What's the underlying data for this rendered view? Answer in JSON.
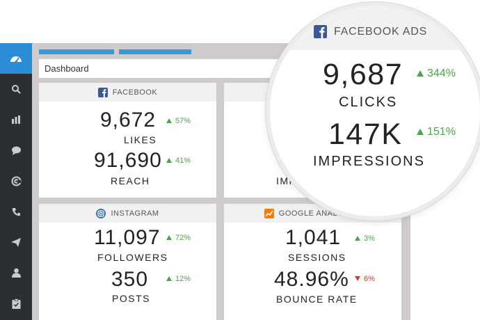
{
  "breadcrumb": "Dashboard",
  "sidebar": {
    "items": [
      {
        "icon": "dashboard-icon",
        "active": true
      },
      {
        "icon": "search-icon"
      },
      {
        "icon": "bar-chart-icon"
      },
      {
        "icon": "chat-icon"
      },
      {
        "icon": "at-sign-icon"
      },
      {
        "icon": "phone-icon"
      },
      {
        "icon": "send-icon"
      },
      {
        "icon": "user-icon"
      },
      {
        "icon": "clipboard-check-icon"
      }
    ]
  },
  "cards": {
    "facebook": {
      "title": "FACEBOOK",
      "metrics": [
        {
          "value": "9,672",
          "label": "LIKES",
          "delta": "57%",
          "direction": "up"
        },
        {
          "value": "91,690",
          "label": "REACH",
          "delta": "41%",
          "direction": "up"
        }
      ]
    },
    "fbads_partial": {
      "label_fragment": "IMP"
    },
    "instagram": {
      "title": "INSTAGRAM",
      "metrics": [
        {
          "value": "11,097",
          "label": "FOLLOWERS",
          "delta": "72%",
          "direction": "up"
        },
        {
          "value": "350",
          "label": "POSTS",
          "delta": "12%",
          "direction": "up"
        }
      ]
    },
    "google_analytics": {
      "title": "GOOGLE ANALYTICS",
      "metrics": [
        {
          "value": "1,041",
          "label": "SESSIONS",
          "delta": "3%",
          "direction": "up"
        },
        {
          "value": "48.96%",
          "label": "BOUNCE RATE",
          "delta": "6%",
          "direction": "down"
        }
      ]
    }
  },
  "magnifier": {
    "title": "FACEBOOK ADS",
    "metrics": [
      {
        "value": "9,687",
        "label": "CLICKS",
        "delta": "344%",
        "direction": "up"
      },
      {
        "value": "147K",
        "label": "IMPRESSIONS",
        "delta": "151%",
        "direction": "up"
      }
    ]
  },
  "colors": {
    "accent": "#2b8dd6",
    "sidebar": "#2b2f33",
    "up": "#4aa648",
    "down": "#d13a3a",
    "facebook": "#3b5998",
    "instagram": "#3f729b",
    "google_analytics": "#f57c00"
  }
}
